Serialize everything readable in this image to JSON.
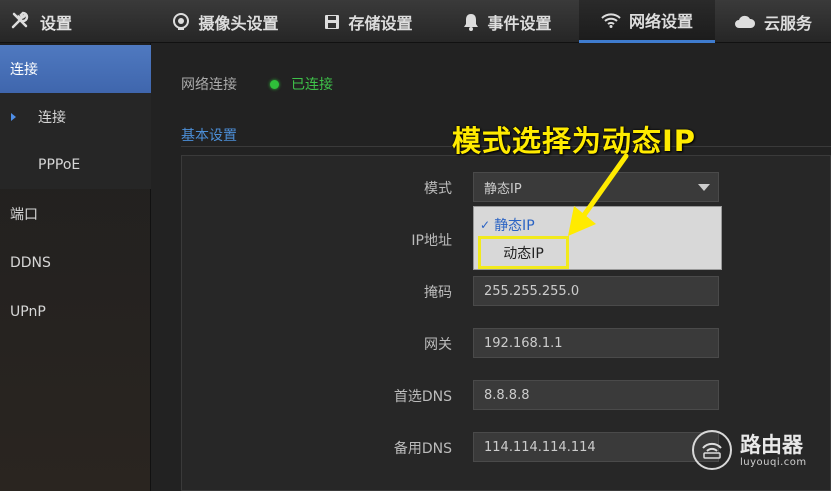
{
  "header": {
    "title": "设置",
    "tabs": [
      {
        "label": "摄像头设置",
        "icon": "camera-icon"
      },
      {
        "label": "存储设置",
        "icon": "save-icon"
      },
      {
        "label": "事件设置",
        "icon": "bell-icon"
      },
      {
        "label": "网络设置",
        "icon": "wifi-icon",
        "active": true
      },
      {
        "label": "云服务",
        "icon": "cloud-icon"
      }
    ]
  },
  "sidebar": {
    "items": [
      {
        "label": "连接",
        "selected": true
      },
      {
        "label": "连接"
      },
      {
        "label": "PPPoE"
      },
      {
        "label": "端口"
      },
      {
        "label": "DDNS"
      },
      {
        "label": "UPnP"
      }
    ]
  },
  "main": {
    "status_label": "网络连接",
    "status_value": "已连接",
    "section_title": "基本设置",
    "fields": {
      "mode_label": "模式",
      "mode_value": "静态IP",
      "ip_label": "IP地址",
      "mask_label": "掩码",
      "mask_value": "255.255.255.0",
      "gateway_label": "网关",
      "gateway_value": "192.168.1.1",
      "dns1_label": "首选DNS",
      "dns1_value": "8.8.8.8",
      "dns2_label": "备用DNS",
      "dns2_value": "114.114.114.114"
    },
    "dropdown": {
      "options": [
        "静态IP",
        "动态IP"
      ]
    }
  },
  "annotation": "模式选择为动态IP",
  "watermark": {
    "big": "路由器",
    "small": "luyouqi.com"
  },
  "colors": {
    "accent": "#3f7ccf",
    "connected": "#3fc24a",
    "highlight": "#f2ea1c"
  }
}
